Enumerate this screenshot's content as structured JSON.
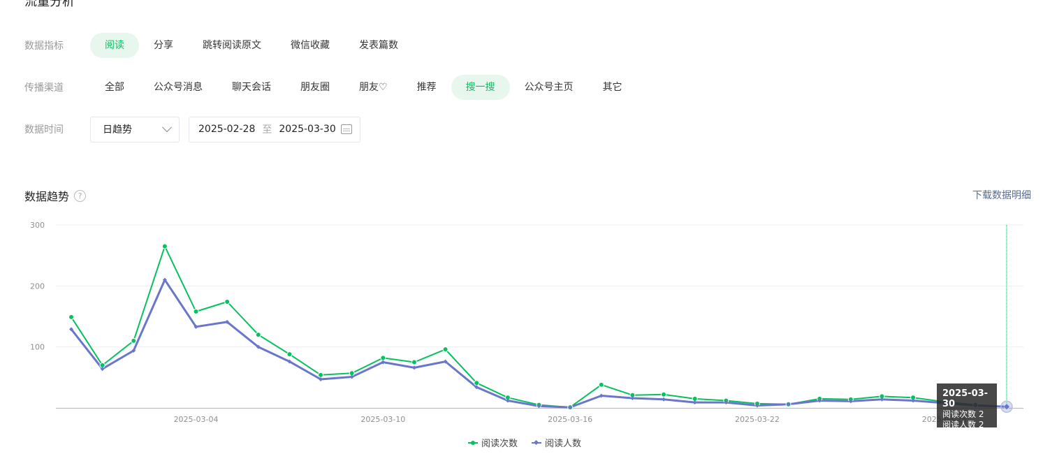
{
  "page_title": "流量分析",
  "filters": {
    "metric": {
      "label": "数据指标",
      "options": [
        "阅读",
        "分享",
        "跳转阅读原文",
        "微信收藏",
        "发表篇数"
      ],
      "active_index": 0
    },
    "channel": {
      "label": "传播渠道",
      "options": [
        "全部",
        "公众号消息",
        "聊天会话",
        "朋友圈",
        "朋友♡",
        "推荐",
        "搜一搜",
        "公众号主页",
        "其它"
      ],
      "active_index": 6
    },
    "time": {
      "label": "数据时间",
      "granularity": "日趋势",
      "start_date": "2025-02-28",
      "separator": "至",
      "end_date": "2025-03-30"
    }
  },
  "section": {
    "title": "数据趋势",
    "help": "?",
    "download_label": "下载数据明细"
  },
  "tooltip": {
    "date": "2025-03-30",
    "line1": "阅读次数 2",
    "line2": "阅读人数 2"
  },
  "colors": {
    "accent": "#07c160",
    "series_reads": "#07c160",
    "series_readers": "#6a76c9",
    "link": "#576b95"
  },
  "chart_data": {
    "type": "line",
    "x": [
      "2025-02-28",
      "2025-03-01",
      "2025-03-02",
      "2025-03-03",
      "2025-03-04",
      "2025-03-05",
      "2025-03-06",
      "2025-03-07",
      "2025-03-08",
      "2025-03-09",
      "2025-03-10",
      "2025-03-11",
      "2025-03-12",
      "2025-03-13",
      "2025-03-14",
      "2025-03-15",
      "2025-03-16",
      "2025-03-17",
      "2025-03-18",
      "2025-03-19",
      "2025-03-20",
      "2025-03-21",
      "2025-03-22",
      "2025-03-23",
      "2025-03-24",
      "2025-03-25",
      "2025-03-26",
      "2025-03-27",
      "2025-03-28",
      "2025-03-29",
      "2025-03-30"
    ],
    "x_tick_labels": [
      "2025-03-04",
      "2025-03-10",
      "2025-03-16",
      "2025-03-22",
      "2025-03-28"
    ],
    "series": [
      {
        "name": "阅读次数",
        "values": [
          149,
          70,
          110,
          265,
          158,
          174,
          120,
          88,
          54,
          57,
          82,
          75,
          96,
          41,
          17,
          5,
          1,
          38,
          21,
          22,
          15,
          12,
          7,
          6,
          15,
          14,
          19,
          17,
          10,
          5,
          2
        ]
      },
      {
        "name": "阅读人数",
        "values": [
          129,
          64,
          94,
          210,
          133,
          141,
          100,
          76,
          47,
          51,
          75,
          66,
          76,
          34,
          12,
          3,
          1,
          20,
          16,
          14,
          9,
          9,
          4,
          6,
          12,
          11,
          14,
          12,
          8,
          4,
          2
        ]
      }
    ],
    "ylim": [
      0,
      300
    ],
    "y_ticks": [
      100,
      200,
      300
    ],
    "grid": true,
    "legend": "bottom-center"
  }
}
